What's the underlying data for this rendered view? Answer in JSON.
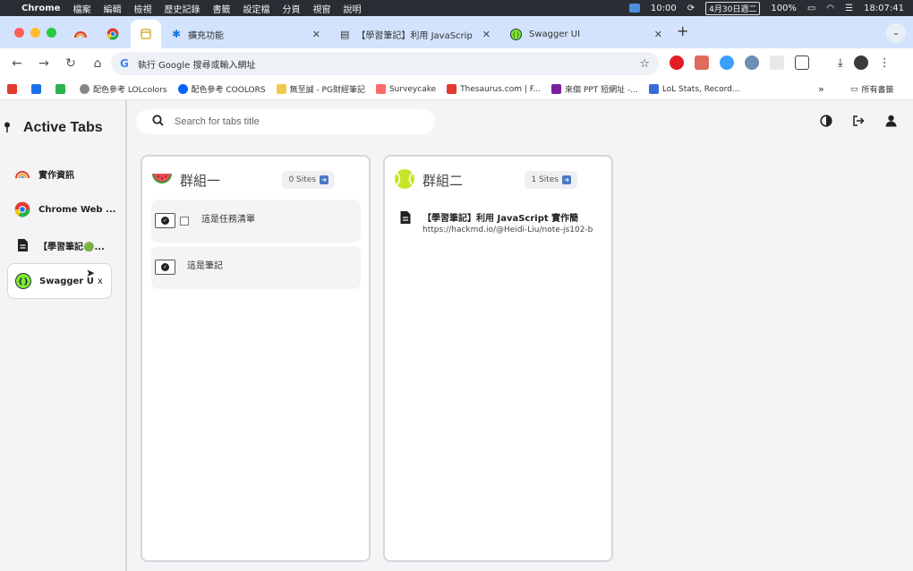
{
  "menubar": {
    "apple": "",
    "items": [
      "Chrome",
      "檔案",
      "編輯",
      "檢視",
      "歷史記錄",
      "書籤",
      "設定檔",
      "分頁",
      "視窗",
      "說明"
    ],
    "clock_small": "10:00",
    "date": "4月30日週二",
    "battery": "100%",
    "time": "18:07:41"
  },
  "tabs": [
    {
      "label": "",
      "icon": "rainbow-icon",
      "active": false
    },
    {
      "label": "",
      "icon": "chrome-icon",
      "active": false
    },
    {
      "label": "",
      "icon": "page-icon",
      "active": true
    },
    {
      "label": "擴充功能",
      "icon": "puzzle-icon",
      "active": false
    },
    {
      "label": "【學習筆記】利用 JavaScript",
      "icon": "document-icon",
      "active": false
    },
    {
      "label": "Swagger UI",
      "icon": "swagger-icon",
      "active": false
    }
  ],
  "omnibox": {
    "placeholder": "執行 Google 搜尋或輸入網址"
  },
  "bookmarks": [
    {
      "label": "",
      "color": "#e33b2e"
    },
    {
      "label": "",
      "color": "#1a73e8"
    },
    {
      "label": "",
      "color": "#2bb24c"
    },
    {
      "label": "配色參考 LOLcolors",
      "color": "#888888"
    },
    {
      "label": "配色參考 COOLORS",
      "color": "#0066ff"
    },
    {
      "label": "無至誠 - PG財經筆記",
      "color": "#f2c94c"
    },
    {
      "label": "Surveycake",
      "color": "#ff6b6b"
    },
    {
      "label": "Thesaurus.com | F...",
      "color": "#e33b2e"
    },
    {
      "label": "來個 PPT 短網址 -...",
      "color": "#7b1fa2"
    },
    {
      "label": "LoL Stats, Record...",
      "color": "#3b6bd6"
    }
  ],
  "bookmarks_more": "»",
  "bookmarks_all": "所有書籤",
  "sidebar": {
    "title": "Active Tabs",
    "items": [
      {
        "label": "實作資訊",
        "icon": "rainbow-icon"
      },
      {
        "label": "Chrome Web ...",
        "icon": "chrome-icon"
      },
      {
        "label": "【學習筆記🟢...",
        "icon": "document-icon"
      },
      {
        "label": "Swagger U",
        "icon": "swagger-icon",
        "close": "x"
      }
    ]
  },
  "search": {
    "placeholder": "Search for tabs title"
  },
  "groups": [
    {
      "name": "群組一",
      "sites": "0 Sites",
      "tasks": [
        "這是任務清單",
        "這是筆記"
      ]
    },
    {
      "name": "群組二",
      "sites": "1 Sites",
      "tab_title": "【學習筆記】利用 JavaScript 實作簡",
      "tab_url": "https://hackmd.io/@Heidi-Liu/note-js102-b"
    }
  ],
  "colors": {
    "accent": "#4a79c4",
    "tabstrip": "#d3e3fd",
    "page": "#f4f4f6"
  }
}
